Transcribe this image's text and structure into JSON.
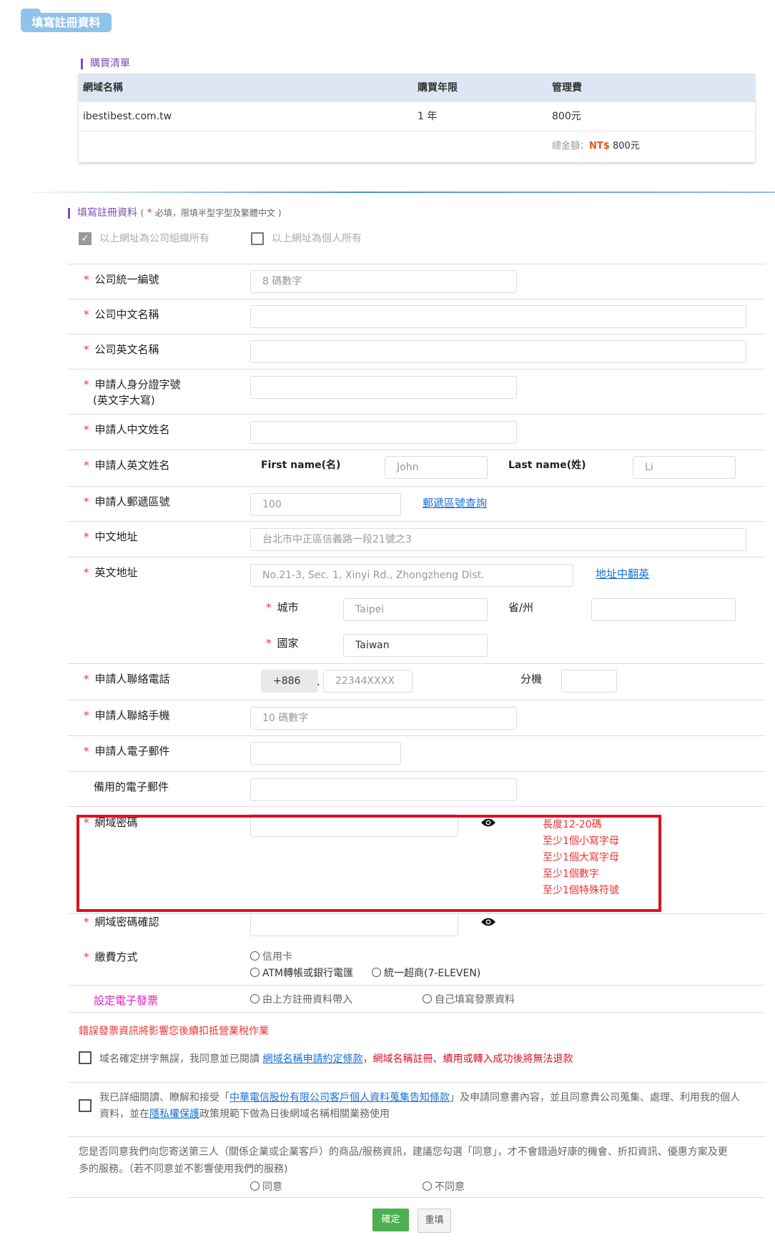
{
  "header": {
    "tag_label": "填寫註冊資料"
  },
  "purchase": {
    "section_title": "購買清單",
    "columns": [
      "網域名稱",
      "購買年限",
      "管理費"
    ],
    "row": {
      "domain": "ibestibest.com.tw",
      "years": "1 年",
      "fee": "800元"
    },
    "total_label": "總金額：",
    "total_currency": "NT$",
    "total_amount": "800元"
  },
  "form": {
    "section_title": "填寫註冊資料",
    "section_note_open": "(",
    "section_note_star": "*",
    "section_note": "必填，限填半型字型及繁體中文 )",
    "owner_company": "以上網址為公司組織所有",
    "owner_person": "以上網址為個人所有",
    "fields": {
      "tax_id": {
        "label": "公司統一編號",
        "placeholder": "8 碼數字"
      },
      "company_zh": {
        "label": "公司中文名稱"
      },
      "company_en": {
        "label": "公司英文名稱"
      },
      "applicant_id": {
        "label": "申請人身分證字號",
        "label_sub": "(英文字大寫)"
      },
      "name_zh": {
        "label": "申請人中文姓名"
      },
      "name_en": {
        "label": "申請人英文姓名",
        "first_label": "First name(名)",
        "first_placeholder": "John",
        "last_label": "Last name(姓)",
        "last_placeholder": "Li"
      },
      "zip": {
        "label": "申請人郵遞區號",
        "placeholder": "100",
        "link": "郵遞區號查詢"
      },
      "addr_zh": {
        "label": "中文地址",
        "placeholder": "台北市中正區信義路一段21號之3"
      },
      "addr_en": {
        "label": "英文地址",
        "placeholder": "No.21-3, Sec. 1, Xinyi Rd., Zhongzheng Dist.",
        "link": "地址中翻英",
        "city_label": "城市",
        "city_placeholder": "Taipei",
        "state_label": "省/州",
        "country_label": "國家",
        "country_value": "Taiwan"
      },
      "phone": {
        "label": "申請人聯絡電話",
        "code": "+886",
        "dot": ".",
        "placeholder": "22344XXXX",
        "ext_label": "分機"
      },
      "mobile": {
        "label": "申請人聯絡手機",
        "placeholder": "10 碼數字"
      },
      "email": {
        "label": "申請人電子郵件"
      },
      "email_backup": {
        "label": "備用的電子郵件"
      },
      "password": {
        "label": "網域密碼",
        "hints": [
          "長度12-20碼",
          "至少1個小寫字母",
          "至少1個大寫字母",
          "至少1個數字",
          "至少1個特殊符號"
        ]
      },
      "password_confirm": {
        "label": "網域密碼確認"
      },
      "payment": {
        "label": "繳費方式",
        "options": [
          "信用卡",
          "ATM轉帳或銀行電匯",
          "統一超商(7-ELEVEN)"
        ]
      },
      "invoice": {
        "label": "設定電子發票",
        "options": [
          "由上方註冊資料帶入",
          "自己填寫發票資料"
        ]
      }
    },
    "invoice_warning": "錯誤發票資訊將影響您後續扣抵營業稅作業",
    "agree1_pre": "域名確定拼字無誤，我同意並已閱讀",
    "agree1_link": "網域名稱申請約定條款",
    "agree1_post": "，網域名稱註冊、續用或轉入成功後將無法退款",
    "agree2_pre": "我已詳細閱讀、瞭解和接受「",
    "agree2_link": "中華電信股份有限公司客戶個人資料蒐集告知條款",
    "agree2_mid": "」及申請同意書內容，並且同意貴公司蒐集、處理、利用我的個人資料，並在",
    "agree2_link2": "隱私權保護",
    "agree2_post": "政策規範下做為日後網域名稱相關業務使用",
    "marketing_text": "您是否同意我們向您寄送第三人（關係企業或企業客戶）的商品/服務資訊，建議您勾選「同意」，才不會錯過好康的機會、折扣資訊、優惠方案及更多的服務。（若不同意並不影響使用我們的服務)",
    "marketing_yes": "同意",
    "marketing_no": "不同意",
    "submit": "確定",
    "reset": "重填"
  },
  "colors": {
    "accent_purple": "#7a4dbb",
    "required_red": "#ee3333",
    "submit_green": "#4caf50",
    "link_blue": "#1a6fd6",
    "highlight_red": "#e01020"
  }
}
